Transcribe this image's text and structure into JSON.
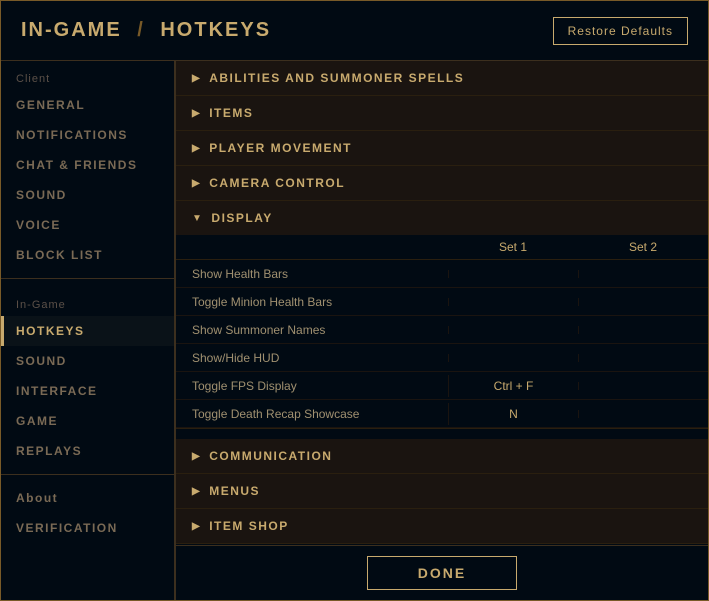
{
  "header": {
    "title_prefix": "IN-GAME",
    "slash": "/",
    "title_highlight": "HOTKEYS",
    "restore_btn": "Restore Defaults"
  },
  "sidebar": {
    "client_label": "Client",
    "items_client": [
      {
        "label": "GENERAL",
        "active": false
      },
      {
        "label": "NOTIFICATIONS",
        "active": false
      },
      {
        "label": "CHAT & FRIENDS",
        "active": false
      },
      {
        "label": "SOUND",
        "active": false
      },
      {
        "label": "VOICE",
        "active": false
      },
      {
        "label": "BLOCK LIST",
        "active": false
      }
    ],
    "ingame_label": "In-Game",
    "items_ingame": [
      {
        "label": "HOTKEYS",
        "active": true
      },
      {
        "label": "SOUND",
        "active": false
      },
      {
        "label": "INTERFACE",
        "active": false
      },
      {
        "label": "GAME",
        "active": false
      },
      {
        "label": "REPLAYS",
        "active": false
      }
    ],
    "about_label": "About",
    "items_about": [
      {
        "label": "VERIFICATION",
        "active": false
      }
    ]
  },
  "content": {
    "sections": [
      {
        "label": "ABILITIES AND SUMMONER SPELLS",
        "expanded": false
      },
      {
        "label": "ITEMS",
        "expanded": false
      },
      {
        "label": "PLAYER MOVEMENT",
        "expanded": false
      },
      {
        "label": "CAMERA CONTROL",
        "expanded": false
      },
      {
        "label": "DISPLAY",
        "expanded": true
      }
    ],
    "table_headers": {
      "set1": "Set 1",
      "set2": "Set 2"
    },
    "hotkey_rows": [
      {
        "name": "Show Health Bars",
        "set1": "",
        "set2": ""
      },
      {
        "name": "Toggle Minion Health Bars",
        "set1": "",
        "set2": ""
      },
      {
        "name": "Show Summoner Names",
        "set1": "",
        "set2": ""
      },
      {
        "name": "Show/Hide HUD",
        "set1": "",
        "set2": ""
      },
      {
        "name": "Toggle FPS Display",
        "set1": "Ctrl + F",
        "set2": ""
      },
      {
        "name": "Toggle Death Recap Showcase",
        "set1": "N",
        "set2": ""
      }
    ],
    "bottom_sections": [
      {
        "label": "COMMUNICATION"
      },
      {
        "label": "MENUS"
      },
      {
        "label": "ITEM SHOP"
      }
    ]
  },
  "footer": {
    "done_btn": "DONE"
  }
}
